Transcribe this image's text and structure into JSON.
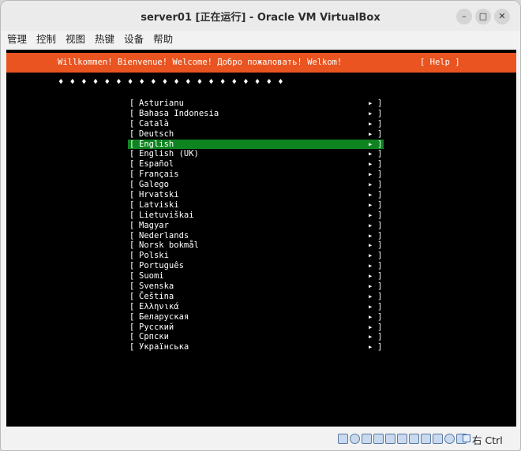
{
  "window": {
    "title": "server01 [正在运行] - Oracle VM VirtualBox",
    "controls": {
      "minimize": "–",
      "maximize": "□",
      "close": "✕"
    }
  },
  "menubar": {
    "items": [
      "管理",
      "控制",
      "视图",
      "热键",
      "设备",
      "帮助"
    ]
  },
  "console": {
    "header": {
      "welcome": "Willkommen! Bienvenue! Welcome! Добро пожаловать! Welkom!",
      "help": "[ Help ]",
      "accent_color": "#e95420"
    },
    "progress_diamonds": "♦ ♦ ♦ ♦ ♦ ♦ ♦ ♦ ♦ ♦ ♦ ♦ ♦ ♦ ♦ ♦ ♦ ♦ ♦ ♦",
    "languages": [
      {
        "label": "Asturianu",
        "selected": false
      },
      {
        "label": "Bahasa Indonesia",
        "selected": false
      },
      {
        "label": "Català",
        "selected": false
      },
      {
        "label": "Deutsch",
        "selected": false
      },
      {
        "label": "English",
        "selected": true
      },
      {
        "label": "English (UK)",
        "selected": false
      },
      {
        "label": "Español",
        "selected": false
      },
      {
        "label": "Français",
        "selected": false
      },
      {
        "label": "Galego",
        "selected": false
      },
      {
        "label": "Hrvatski",
        "selected": false
      },
      {
        "label": "Latviski",
        "selected": false
      },
      {
        "label": "Lietuviškai",
        "selected": false
      },
      {
        "label": "Magyar",
        "selected": false
      },
      {
        "label": "Nederlands",
        "selected": false
      },
      {
        "label": "Norsk bokmål",
        "selected": false
      },
      {
        "label": "Polski",
        "selected": false
      },
      {
        "label": "Português",
        "selected": false
      },
      {
        "label": "Suomi",
        "selected": false
      },
      {
        "label": "Svenska",
        "selected": false
      },
      {
        "label": "Čeština",
        "selected": false
      },
      {
        "label": "Ελληνικά",
        "selected": false
      },
      {
        "label": "Беларуская",
        "selected": false
      },
      {
        "label": "Русский",
        "selected": false
      },
      {
        "label": "Српски",
        "selected": false
      },
      {
        "label": "Українська",
        "selected": false
      }
    ],
    "item_open": "[",
    "item_arrow": "▸",
    "item_close": "]",
    "selected_color": "#0e8420"
  },
  "statusbar": {
    "icons": [
      "hard-disk-icon",
      "optical-drive-icon",
      "audio-icon",
      "network-icon",
      "usb-icon",
      "shared-folder-icon",
      "display-icon",
      "recording-icon",
      "cpu-icon",
      "mouse-integration-icon",
      "keyboard-icon"
    ],
    "host_key": "右 Ctrl"
  }
}
